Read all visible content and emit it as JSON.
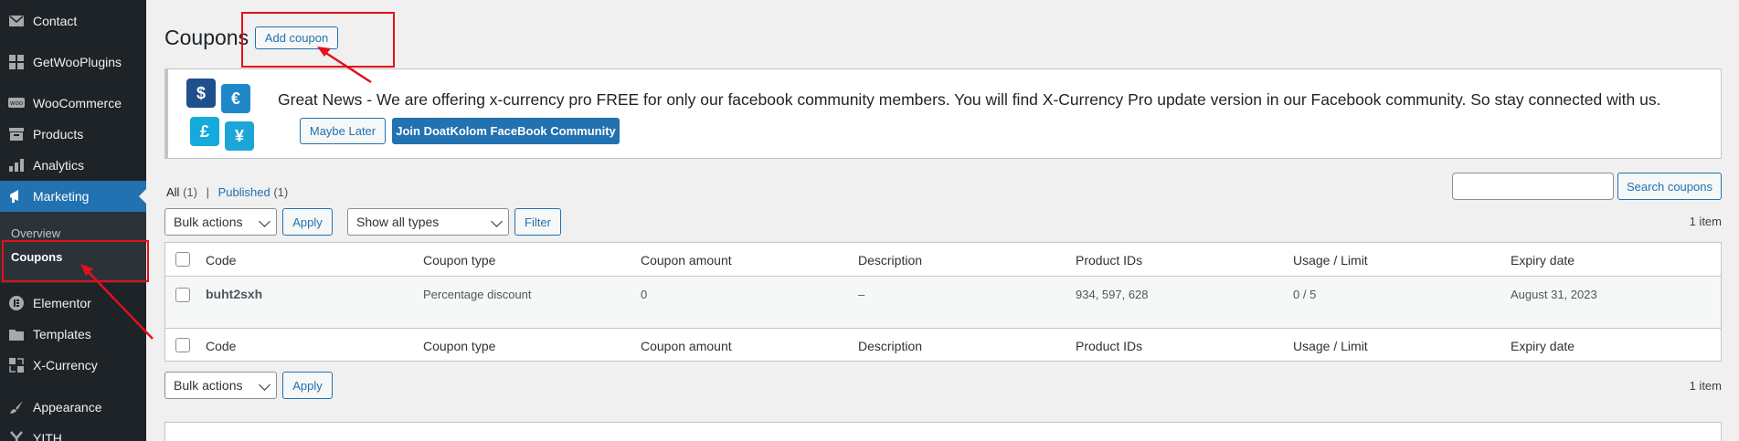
{
  "sidebar": {
    "items": [
      {
        "label": "Contact",
        "icon": "envelope-icon"
      },
      {
        "label": "GetWooPlugins",
        "icon": "plugin-grid-icon"
      },
      {
        "label": "WooCommerce",
        "icon": "woocommerce-icon"
      },
      {
        "label": "Products",
        "icon": "archive-box-icon"
      },
      {
        "label": "Analytics",
        "icon": "bar-chart-icon"
      },
      {
        "label": "Marketing",
        "icon": "megaphone-icon"
      },
      {
        "label": "Elementor",
        "icon": "elementor-icon"
      },
      {
        "label": "Templates",
        "icon": "folder-icon"
      },
      {
        "label": "X-Currency",
        "icon": "currency-icon"
      },
      {
        "label": "Appearance",
        "icon": "brush-icon"
      },
      {
        "label": "YITH",
        "icon": "yith-icon"
      }
    ],
    "submenu": {
      "overview": "Overview",
      "coupons": "Coupons"
    }
  },
  "header": {
    "title": "Coupons",
    "add_button": "Add coupon"
  },
  "notice": {
    "text": "Great News - We are offering x-currency pro FREE for only our facebook community members. You will find X-Currency Pro update version in our Facebook community. So stay connected with us.",
    "maybe_later": "Maybe Later",
    "join_button": "Join DoatKolom FaceBook Community",
    "currency_symbols": [
      "$",
      "€",
      "£",
      "¥"
    ]
  },
  "filters": {
    "all_label": "All",
    "all_count": "(1)",
    "separator": "|",
    "published_label": "Published",
    "published_count": "(1)",
    "bulk_actions": "Bulk actions",
    "apply": "Apply",
    "type_select": "Show all types",
    "filter": "Filter",
    "search_button": "Search coupons",
    "search_value": "",
    "item_count": "1 item"
  },
  "table": {
    "columns": [
      "Code",
      "Coupon type",
      "Coupon amount",
      "Description",
      "Product IDs",
      "Usage / Limit",
      "Expiry date"
    ],
    "rows": [
      {
        "code": "buht2sxh",
        "type": "Percentage discount",
        "amount": "0",
        "description": "–",
        "product_ids": "934, 597, 628",
        "usage": "0 / 5",
        "expiry": "August 31, 2023"
      }
    ]
  },
  "bottom": {
    "bulk_actions": "Bulk actions",
    "apply": "Apply",
    "item_count": "1 item"
  },
  "colors": {
    "accent": "#2271b1",
    "sidebar": "#1d2327",
    "highlight": "#e2101a"
  }
}
